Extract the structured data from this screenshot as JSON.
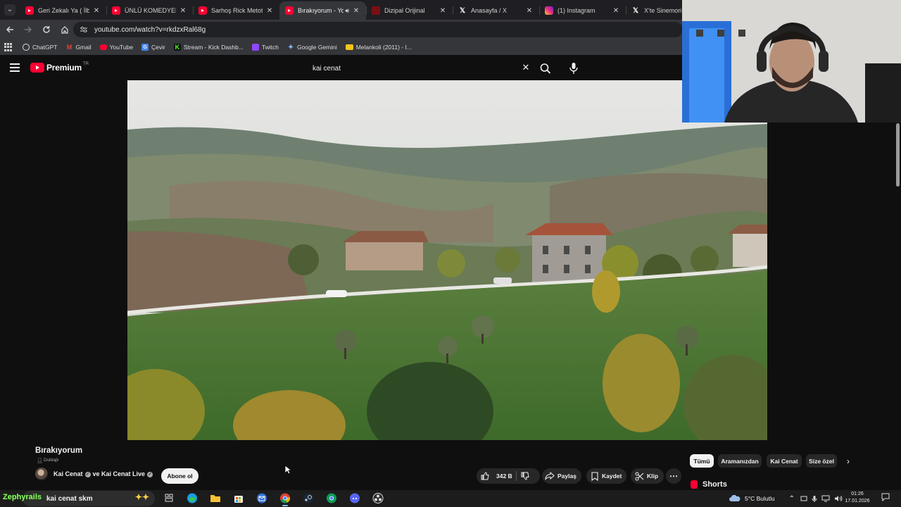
{
  "browser": {
    "tabs": [
      {
        "label": "Geri Zekalı Ya ( İlber O",
        "favicon": "youtube-icon",
        "active": false
      },
      {
        "label": "ÜNLÜ KOMEDYENLER",
        "favicon": "youtube-icon",
        "active": false
      },
      {
        "label": "Sarhoş Rick Metot Oy",
        "favicon": "youtube-icon",
        "active": false
      },
      {
        "label": "Bırakıyorum - You",
        "favicon": "youtube-icon",
        "active": true
      },
      {
        "label": "Dizipal Orijinal",
        "favicon": "dizipal-icon",
        "active": false
      },
      {
        "label": "Anasayfa / X",
        "favicon": "x-icon",
        "active": false
      },
      {
        "label": "(1) Instagram",
        "favicon": "instagram-icon",
        "active": false
      },
      {
        "label": "X'te Sinemori: \"Te",
        "favicon": "x-icon",
        "active": false
      }
    ],
    "url": "youtube.com/watch?v=rkdzxRal68g",
    "bookmarks": [
      {
        "label": "ChatGPT",
        "icon": "chatgpt-icon",
        "color": "#dddddd"
      },
      {
        "label": "Gmail",
        "icon": "gmail-icon",
        "color": "#ea4335"
      },
      {
        "label": "YouTube",
        "icon": "youtube-icon",
        "color": "#ff0033"
      },
      {
        "label": "Çevir",
        "icon": "translate-icon",
        "color": "#4285f4"
      },
      {
        "label": "Stream - Kick Dashb...",
        "icon": "kick-icon",
        "color": "#53fc18"
      },
      {
        "label": "Twitch",
        "icon": "twitch-icon",
        "color": "#9146ff"
      },
      {
        "label": "Google Gemini",
        "icon": "gemini-icon",
        "color": "#8ab4f8"
      },
      {
        "label": "Melankoli (2011) - I...",
        "icon": "imdb-icon",
        "color": "#f5c518"
      }
    ]
  },
  "youtube": {
    "logo_text": "Premium",
    "logo_country": "TR",
    "search_value": "kai cenat",
    "video": {
      "title": "Bırakıyorum",
      "badge": "Dublajlı",
      "channel": "Kai Cenat",
      "channel_joiner": "ve",
      "channel2": "Kai Cenat Live",
      "subscribe_label": "Abone ol",
      "likes": "342 B",
      "share_label": "Paylaş",
      "save_label": "Kaydet",
      "clip_label": "Klip",
      "more_label": "⋯"
    },
    "chips": [
      "Tümü",
      "Aramanızdan",
      "Kai Cenat",
      "Size özel"
    ],
    "shorts_label": "Shorts",
    "accent": "#ff0033"
  },
  "stream_overlay": {
    "text": "Zephyrails"
  },
  "taskbar": {
    "search_value": "kai cenat skm",
    "weather": "5°C  Bulutlu",
    "time": "01:26",
    "date": "17.01.2026",
    "apps": [
      "task-view-icon",
      "edge-icon",
      "file-explorer-icon",
      "store-icon",
      "mail-icon",
      "chrome-icon",
      "steam-icon",
      "chrome-profile-icon",
      "discord-icon",
      "obs-icon"
    ]
  }
}
